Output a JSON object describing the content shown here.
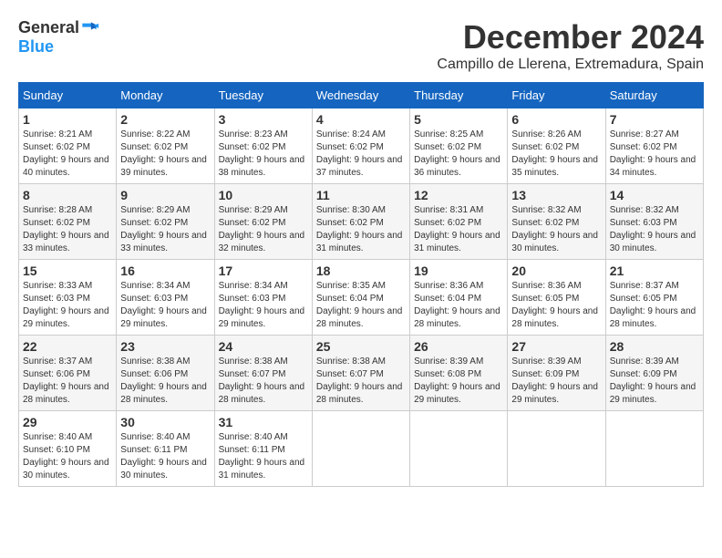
{
  "logo": {
    "general": "General",
    "blue": "Blue"
  },
  "title": "December 2024",
  "subtitle": "Campillo de Llerena, Extremadura, Spain",
  "weekdays": [
    "Sunday",
    "Monday",
    "Tuesday",
    "Wednesday",
    "Thursday",
    "Friday",
    "Saturday"
  ],
  "weeks": [
    [
      {
        "day": "1",
        "sunrise": "8:21 AM",
        "sunset": "6:02 PM",
        "daylight": "9 hours and 40 minutes."
      },
      {
        "day": "2",
        "sunrise": "8:22 AM",
        "sunset": "6:02 PM",
        "daylight": "9 hours and 39 minutes."
      },
      {
        "day": "3",
        "sunrise": "8:23 AM",
        "sunset": "6:02 PM",
        "daylight": "9 hours and 38 minutes."
      },
      {
        "day": "4",
        "sunrise": "8:24 AM",
        "sunset": "6:02 PM",
        "daylight": "9 hours and 37 minutes."
      },
      {
        "day": "5",
        "sunrise": "8:25 AM",
        "sunset": "6:02 PM",
        "daylight": "9 hours and 36 minutes."
      },
      {
        "day": "6",
        "sunrise": "8:26 AM",
        "sunset": "6:02 PM",
        "daylight": "9 hours and 35 minutes."
      },
      {
        "day": "7",
        "sunrise": "8:27 AM",
        "sunset": "6:02 PM",
        "daylight": "9 hours and 34 minutes."
      }
    ],
    [
      {
        "day": "8",
        "sunrise": "8:28 AM",
        "sunset": "6:02 PM",
        "daylight": "9 hours and 33 minutes."
      },
      {
        "day": "9",
        "sunrise": "8:29 AM",
        "sunset": "6:02 PM",
        "daylight": "9 hours and 33 minutes."
      },
      {
        "day": "10",
        "sunrise": "8:29 AM",
        "sunset": "6:02 PM",
        "daylight": "9 hours and 32 minutes."
      },
      {
        "day": "11",
        "sunrise": "8:30 AM",
        "sunset": "6:02 PM",
        "daylight": "9 hours and 31 minutes."
      },
      {
        "day": "12",
        "sunrise": "8:31 AM",
        "sunset": "6:02 PM",
        "daylight": "9 hours and 31 minutes."
      },
      {
        "day": "13",
        "sunrise": "8:32 AM",
        "sunset": "6:02 PM",
        "daylight": "9 hours and 30 minutes."
      },
      {
        "day": "14",
        "sunrise": "8:32 AM",
        "sunset": "6:03 PM",
        "daylight": "9 hours and 30 minutes."
      }
    ],
    [
      {
        "day": "15",
        "sunrise": "8:33 AM",
        "sunset": "6:03 PM",
        "daylight": "9 hours and 29 minutes."
      },
      {
        "day": "16",
        "sunrise": "8:34 AM",
        "sunset": "6:03 PM",
        "daylight": "9 hours and 29 minutes."
      },
      {
        "day": "17",
        "sunrise": "8:34 AM",
        "sunset": "6:03 PM",
        "daylight": "9 hours and 29 minutes."
      },
      {
        "day": "18",
        "sunrise": "8:35 AM",
        "sunset": "6:04 PM",
        "daylight": "9 hours and 28 minutes."
      },
      {
        "day": "19",
        "sunrise": "8:36 AM",
        "sunset": "6:04 PM",
        "daylight": "9 hours and 28 minutes."
      },
      {
        "day": "20",
        "sunrise": "8:36 AM",
        "sunset": "6:05 PM",
        "daylight": "9 hours and 28 minutes."
      },
      {
        "day": "21",
        "sunrise": "8:37 AM",
        "sunset": "6:05 PM",
        "daylight": "9 hours and 28 minutes."
      }
    ],
    [
      {
        "day": "22",
        "sunrise": "8:37 AM",
        "sunset": "6:06 PM",
        "daylight": "9 hours and 28 minutes."
      },
      {
        "day": "23",
        "sunrise": "8:38 AM",
        "sunset": "6:06 PM",
        "daylight": "9 hours and 28 minutes."
      },
      {
        "day": "24",
        "sunrise": "8:38 AM",
        "sunset": "6:07 PM",
        "daylight": "9 hours and 28 minutes."
      },
      {
        "day": "25",
        "sunrise": "8:38 AM",
        "sunset": "6:07 PM",
        "daylight": "9 hours and 28 minutes."
      },
      {
        "day": "26",
        "sunrise": "8:39 AM",
        "sunset": "6:08 PM",
        "daylight": "9 hours and 29 minutes."
      },
      {
        "day": "27",
        "sunrise": "8:39 AM",
        "sunset": "6:09 PM",
        "daylight": "9 hours and 29 minutes."
      },
      {
        "day": "28",
        "sunrise": "8:39 AM",
        "sunset": "6:09 PM",
        "daylight": "9 hours and 29 minutes."
      }
    ],
    [
      {
        "day": "29",
        "sunrise": "8:40 AM",
        "sunset": "6:10 PM",
        "daylight": "9 hours and 30 minutes."
      },
      {
        "day": "30",
        "sunrise": "8:40 AM",
        "sunset": "6:11 PM",
        "daylight": "9 hours and 30 minutes."
      },
      {
        "day": "31",
        "sunrise": "8:40 AM",
        "sunset": "6:11 PM",
        "daylight": "9 hours and 31 minutes."
      },
      null,
      null,
      null,
      null
    ]
  ]
}
